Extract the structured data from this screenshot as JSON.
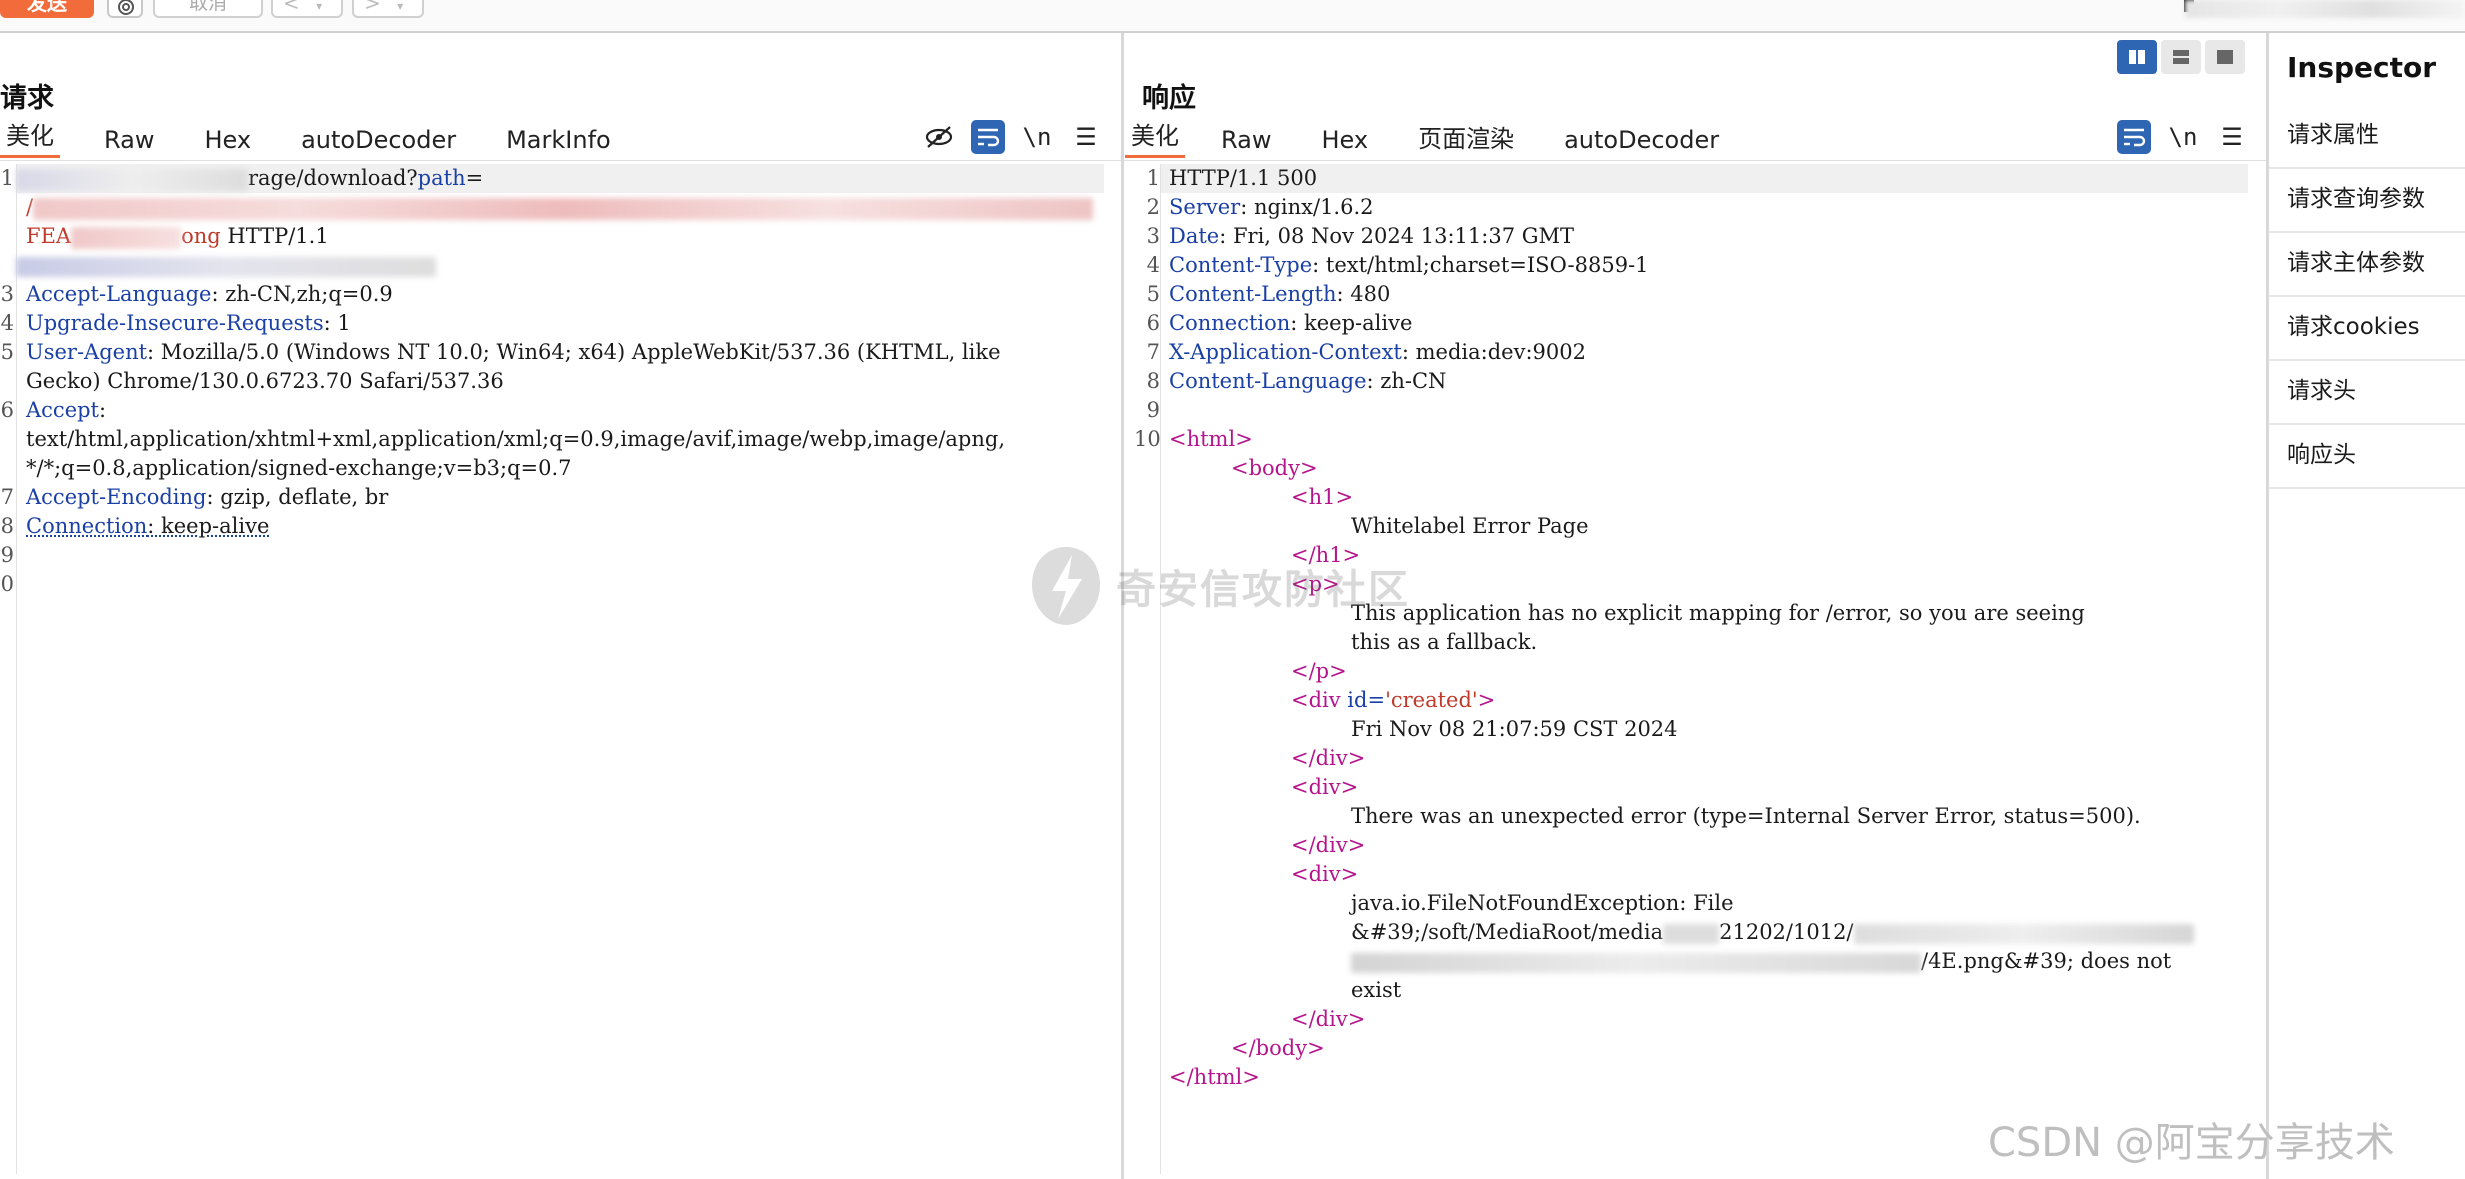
{
  "toolbar": {
    "send_label": "发送",
    "cancel_label": "取消",
    "back_label": "<",
    "forward_label": ">",
    "dropdown_glyph": "▾"
  },
  "request": {
    "title": "请求",
    "tabs": [
      "美化",
      "Raw",
      "Hex",
      "autoDecoder",
      "MarkInfo"
    ],
    "active_tab": "美化",
    "gutter": [
      "1",
      "",
      "",
      "",
      "3",
      "4",
      "5",
      "",
      "6",
      "",
      "",
      "7",
      "8",
      "9",
      "0"
    ],
    "line1_visible": "rage/download?",
    "line1_key": "path",
    "line1_eq": "=",
    "line2_visible": "/",
    "line3_visible_a": "FEA",
    "line3_visible_b": "ong",
    "line3_protocol": " HTTP/1.1",
    "accept_language_key": "Accept-Language",
    "accept_language_value": ": zh-CN,zh;q=0.9",
    "upgrade_key": "Upgrade-Insecure-Requests",
    "upgrade_value": ": 1",
    "user_agent_key": "User-Agent",
    "user_agent_value_1": ": Mozilla/5.0 (Windows NT 10.0; Win64; x64) AppleWebKit/537.36 (KHTML, like",
    "user_agent_value_2": "Gecko) Chrome/130.0.6723.70 Safari/537.36",
    "accept_key": "Accept",
    "accept_colon": ":",
    "accept_value_1": "text/html,application/xhtml+xml,application/xml;q=0.9,image/avif,image/webp,image/apng,",
    "accept_value_2": "*/*;q=0.8,application/signed-exchange;v=b3;q=0.7",
    "accept_encoding_key": "Accept-Encoding",
    "accept_encoding_value": ": gzip, deflate, br",
    "connection_key": "Connection",
    "connection_value": ": keep-alive"
  },
  "response": {
    "title": "响应",
    "tabs": [
      "美化",
      "Raw",
      "Hex",
      "页面渲染",
      "autoDecoder"
    ],
    "active_tab": "美化",
    "gutter": [
      "1",
      "2",
      "3",
      "4",
      "5",
      "6",
      "7",
      "8",
      "9",
      "10"
    ],
    "status_line": "HTTP/1.1 500",
    "headers": [
      {
        "key": "Server",
        "value": ": nginx/1.6.2"
      },
      {
        "key": "Date",
        "value": ": Fri, 08 Nov 2024 13:11:37 GMT"
      },
      {
        "key": "Content-Type",
        "value": ": text/html;charset=ISO-8859-1"
      },
      {
        "key": "Content-Length",
        "value": ": 480"
      },
      {
        "key": "Connection",
        "value": ": keep-alive"
      },
      {
        "key": "X-Application-Context",
        "value": ": media:dev:9002"
      },
      {
        "key": "Content-Language",
        "value": ": zh-CN"
      }
    ],
    "body": {
      "html_open": "<html>",
      "body_open": "<body>",
      "h1_open": "<h1>",
      "h1_text": "Whitelabel Error Page",
      "h1_close": "</h1>",
      "p_open": "<p>",
      "p_text_1": "This application has no explicit mapping for /error, so you are seeing",
      "p_text_2": "this as a fallback.",
      "p_close": "</p>",
      "div_created_tag": "<div ",
      "div_created_attr": "id=",
      "div_created_val": "'created'",
      "div_created_end": ">",
      "created_text": "Fri Nov 08 21:07:59 CST 2024",
      "div_close": "</div>",
      "div_open": "<div>",
      "error_text": "There was an unexpected error (type=Internal Server Error, status=500).",
      "exception_1": "java.io.FileNotFoundException: File",
      "exception_2": "&#39;/soft/MediaRoot/media",
      "exception_2b": "21202/1012/",
      "exception_3_end": "/4E.png&#39; does not",
      "exception_4": "exist",
      "body_close": "</body>",
      "html_close": "</html>"
    }
  },
  "inspector": {
    "title": "Inspector",
    "items": [
      "请求属性",
      "请求查询参数",
      "请求主体参数",
      "请求cookies",
      "请求头",
      "响应头"
    ]
  },
  "watermarks": {
    "center": "奇安信攻防社区",
    "corner": "CSDN @阿宝分享技术"
  },
  "colors": {
    "accent": "#f26b3a",
    "blue": "#2f66b3",
    "header_key": "#1a3fa5",
    "tag": "#b5158c",
    "string": "#c0392b"
  }
}
